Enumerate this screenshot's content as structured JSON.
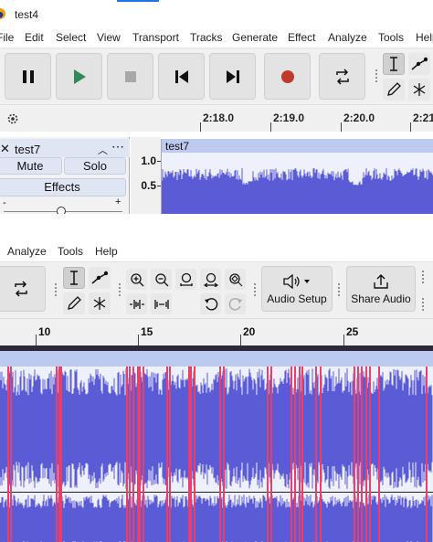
{
  "window": {
    "title": "test4"
  },
  "menu": [
    "File",
    "Edit",
    "Select",
    "View",
    "Transport",
    "Tracks",
    "Generate",
    "Effect",
    "Analyze",
    "Tools",
    "Help"
  ],
  "ruler_top": {
    "labels": [
      "2:18.0",
      "2:19.0",
      "2:20.0",
      "2:21"
    ]
  },
  "track": {
    "name": "test7",
    "mute_label": "Mute",
    "solo_label": "Solo",
    "effects_label": "Effects",
    "slider_minus": "-",
    "slider_plus": "+",
    "scale_labels": [
      "1.0",
      "0.5"
    ],
    "clip_name": "test7"
  },
  "menu2": [
    "Analyze",
    "Tools",
    "Help"
  ],
  "toolbar2": {
    "audio_setup_label": "Audio Setup",
    "share_audio_label": "Share Audio"
  },
  "ruler_bottom": {
    "labels": [
      "10",
      "15",
      "20",
      "25"
    ]
  },
  "colors": {
    "waveform": "#5b5bd6",
    "selection": "#e8406a",
    "clip_header": "#bdcaf0",
    "record": "#c0392b",
    "play": "#2e8b57"
  }
}
